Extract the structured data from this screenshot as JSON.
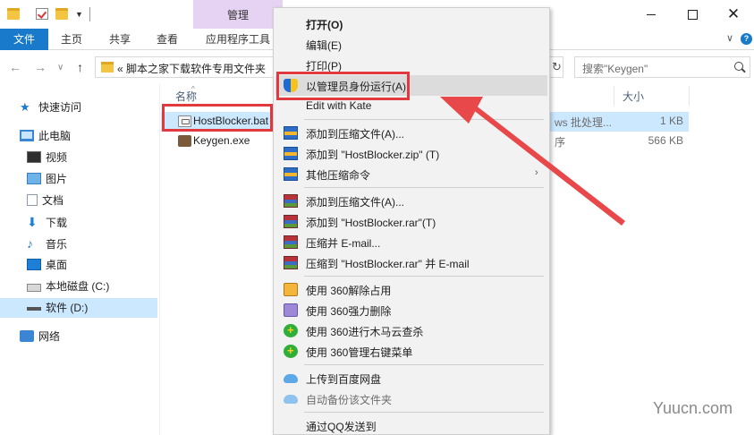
{
  "window": {
    "manage_tab": "管理",
    "close_glyph": "✕"
  },
  "ribbon": {
    "tabs": [
      "文件",
      "主页",
      "共享",
      "查看",
      "应用程序工具"
    ]
  },
  "address": {
    "back": "←",
    "forward": "→",
    "recent": "∨",
    "up": "↑",
    "path": "«  脚本之家下载软件专用文件夹",
    "refresh": "↻"
  },
  "search": {
    "placeholder": "搜索\"Keygen\""
  },
  "navpane": {
    "quick_access": "快速访问",
    "this_pc": "此电脑",
    "items": [
      "视频",
      "图片",
      "文档",
      "下载",
      "音乐",
      "桌面",
      "本地磁盘 (C:)",
      "软件 (D:)"
    ],
    "network": "网络"
  },
  "filelist": {
    "headers": {
      "name": "名称",
      "size": "大小"
    },
    "rows": [
      {
        "name": "HostBlocker.bat",
        "type": "ws 批处理...",
        "size": "1 KB"
      },
      {
        "name": "Keygen.exe",
        "type": "序",
        "size": "566 KB"
      }
    ]
  },
  "context_menu": {
    "items": [
      "打开(O)",
      "编辑(E)",
      "打印(P)",
      "以管理员身份运行(A)",
      "Edit with Kate",
      "添加到压缩文件(A)...",
      "添加到 \"HostBlocker.zip\" (T)",
      "其他压缩命令",
      "添加到压缩文件(A)...",
      "添加到 \"HostBlocker.rar\"(T)",
      "压缩并 E-mail...",
      "压缩到 \"HostBlocker.rar\" 并 E-mail",
      "使用 360解除占用",
      "使用 360强力删除",
      "使用 360进行木马云查杀",
      "使用 360管理右键菜单",
      "上传到百度网盘",
      "自动备份该文件夹",
      "通过QQ发送到"
    ],
    "submenu_arrow": "›"
  },
  "watermark": "Yuucn.com",
  "colors": {
    "accent_blue": "#1979ca",
    "manage_tab_bg": "#e6d2f2",
    "highlight_red": "#e0393e",
    "selection_bg": "#cce8ff",
    "menu_bg": "#f2f2f2"
  }
}
